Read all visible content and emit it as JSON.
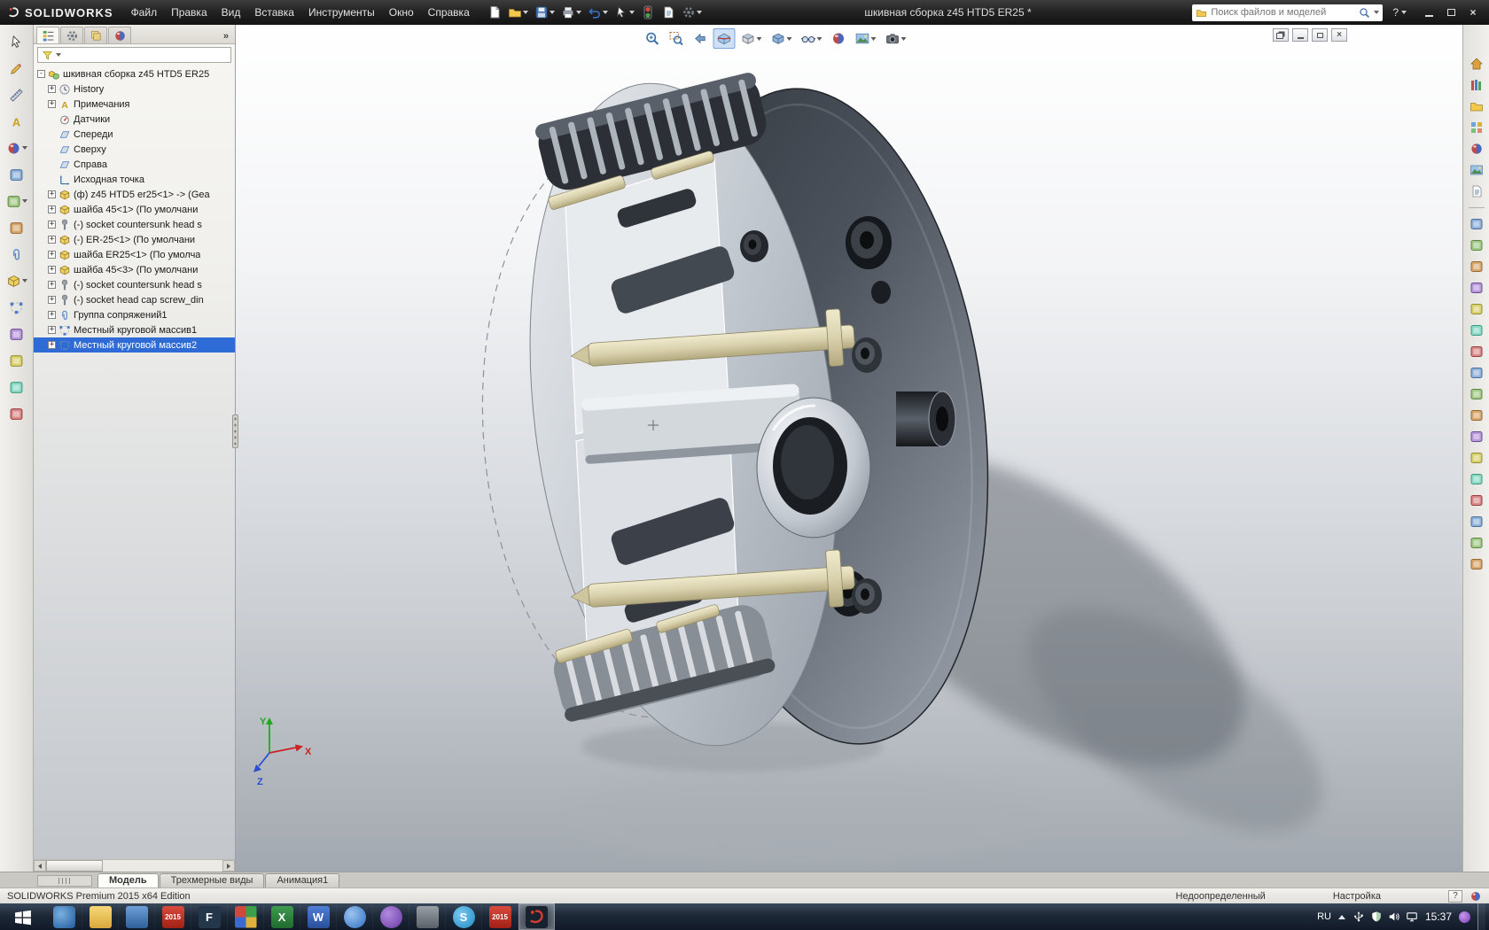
{
  "titlebar": {
    "app_name": "SOLIDWORKS",
    "document_title": "шкивная сборка z45 HTD5 ER25 *",
    "search_placeholder": "Поиск файлов и моделей",
    "help_label": "?",
    "menus": [
      "Файл",
      "Правка",
      "Вид",
      "Вставка",
      "Инструменты",
      "Окно",
      "Справка"
    ],
    "quick_tools": [
      {
        "name": "new-document-icon",
        "icon": "new",
        "caret": false
      },
      {
        "name": "open-icon",
        "icon": "open",
        "caret": true
      },
      {
        "name": "save-icon",
        "icon": "save",
        "caret": true
      },
      {
        "name": "print-icon",
        "icon": "print",
        "caret": true
      },
      {
        "name": "undo-icon",
        "icon": "undo",
        "caret": true
      },
      {
        "name": "select-icon",
        "icon": "cursor",
        "caret": true
      },
      {
        "name": "rebuild-icon",
        "icon": "rebuild",
        "caret": false
      },
      {
        "name": "file-properties-icon",
        "icon": "props",
        "caret": false
      },
      {
        "name": "options-icon",
        "icon": "gear",
        "caret": true
      }
    ]
  },
  "left_toolbar": [
    {
      "name": "select-tool",
      "icon": "cursor",
      "caret": false
    },
    {
      "name": "sketch-tool",
      "icon": "pencil",
      "caret": false
    },
    {
      "name": "dimension-tool",
      "icon": "ruler",
      "caret": false
    },
    {
      "name": "annotation-tool",
      "icon": "annA",
      "caret": false
    },
    {
      "name": "appearance-tool",
      "icon": "ball",
      "caret": true
    },
    {
      "name": "measure-tool",
      "icon": "gen1",
      "caret": false
    },
    {
      "name": "mass-properties-tool",
      "icon": "gen2",
      "caret": true
    },
    {
      "name": "interference-tool",
      "icon": "gen3",
      "caret": false
    },
    {
      "name": "mate-tool",
      "icon": "mates",
      "caret": false
    },
    {
      "name": "component-tool",
      "icon": "part",
      "caret": true
    },
    {
      "name": "pattern-tool",
      "icon": "pattern",
      "caret": false
    },
    {
      "name": "exploded-view-tool",
      "icon": "gen4",
      "caret": false
    },
    {
      "name": "assembly-features-tool",
      "icon": "gen5",
      "caret": false
    },
    {
      "name": "motion-tool",
      "icon": "gen6",
      "caret": false
    },
    {
      "name": "simulation-tool",
      "icon": "gen7",
      "caret": false
    }
  ],
  "feature_manager": {
    "tabs": [
      "featuremanager-tab",
      "propertymanager-tab",
      "configurationmanager-tab",
      "displaymanager-tab"
    ],
    "overflow_glyph": "»",
    "tree": [
      {
        "label": "шкивная сборка z45 HTD5 ER25",
        "icon": "asm",
        "expand": "minus",
        "indent": 0,
        "selected": false
      },
      {
        "label": "History",
        "icon": "hist",
        "expand": "plus",
        "indent": 1,
        "selected": false
      },
      {
        "label": "Примечания",
        "icon": "annA",
        "expand": "plus",
        "indent": 1,
        "selected": false
      },
      {
        "label": "Датчики",
        "icon": "sens",
        "expand": "none",
        "indent": 1,
        "selected": false
      },
      {
        "label": "Спереди",
        "icon": "plane",
        "expand": "none",
        "indent": 1,
        "selected": false
      },
      {
        "label": "Сверху",
        "icon": "plane",
        "expand": "none",
        "indent": 1,
        "selected": false
      },
      {
        "label": "Справа",
        "icon": "plane",
        "expand": "none",
        "indent": 1,
        "selected": false
      },
      {
        "label": "Исходная точка",
        "icon": "origin",
        "expand": "none",
        "indent": 1,
        "selected": false
      },
      {
        "label": "(ф) z45 HTD5 er25<1> -> (Gea",
        "icon": "part",
        "expand": "plus",
        "indent": 1,
        "selected": false
      },
      {
        "label": "шайба 45<1> (По умолчани",
        "icon": "part",
        "expand": "plus",
        "indent": 1,
        "selected": false
      },
      {
        "label": "(-) socket countersunk head s",
        "icon": "screw",
        "expand": "plus",
        "indent": 1,
        "selected": false
      },
      {
        "label": "(-) ER-25<1> (По умолчани",
        "icon": "part",
        "expand": "plus",
        "indent": 1,
        "selected": false
      },
      {
        "label": "шайба ER25<1> (По умолча",
        "icon": "part",
        "expand": "plus",
        "indent": 1,
        "selected": false
      },
      {
        "label": "шайба 45<3> (По умолчани",
        "icon": "part",
        "expand": "plus",
        "indent": 1,
        "selected": false
      },
      {
        "label": "(-) socket countersunk head s",
        "icon": "screw",
        "expand": "plus",
        "indent": 1,
        "selected": false
      },
      {
        "label": "(-) socket head cap screw_din",
        "icon": "screw",
        "expand": "plus",
        "indent": 1,
        "selected": false
      },
      {
        "label": "Группа сопряжений1",
        "icon": "mates",
        "expand": "plus",
        "indent": 1,
        "selected": false
      },
      {
        "label": "Местный круговой массив1",
        "icon": "pattern",
        "expand": "plus",
        "indent": 1,
        "selected": false
      },
      {
        "label": "Местный круговой массив2",
        "icon": "pattern",
        "expand": "plus",
        "indent": 1,
        "selected": true
      }
    ]
  },
  "viewport": {
    "headsup": [
      {
        "name": "zoom-fit-icon",
        "icon": "magfit",
        "caret": false,
        "active": false
      },
      {
        "name": "zoom-area-icon",
        "icon": "magarea",
        "caret": false,
        "active": false
      },
      {
        "name": "previous-view-icon",
        "icon": "prevview",
        "caret": false,
        "active": false
      },
      {
        "name": "section-view-icon",
        "icon": "section",
        "caret": false,
        "active": true
      },
      {
        "name": "view-orientation-icon",
        "icon": "cube",
        "caret": true,
        "active": false
      },
      {
        "name": "display-style-icon",
        "icon": "displaycube",
        "caret": true,
        "active": false
      },
      {
        "name": "hide-show-items-icon",
        "icon": "glasses",
        "caret": true,
        "active": false
      },
      {
        "name": "edit-appearance-icon",
        "icon": "ball",
        "caret": false,
        "active": false
      },
      {
        "name": "apply-scene-icon",
        "icon": "scene",
        "caret": true,
        "active": false
      },
      {
        "name": "view-settings-icon",
        "icon": "camera",
        "caret": true,
        "active": false
      }
    ],
    "triad": {
      "x": "X",
      "y": "Y",
      "z": "Z"
    }
  },
  "task_pane": [
    {
      "name": "solidworks-resources-icon",
      "icon": "home"
    },
    {
      "name": "design-library-icon",
      "icon": "books"
    },
    {
      "name": "file-explorer-icon",
      "icon": "open"
    },
    {
      "name": "view-palette-icon",
      "icon": "palette"
    },
    {
      "name": "appearances-icon",
      "icon": "ball"
    },
    {
      "name": "scenes-icon",
      "icon": "scene"
    },
    {
      "name": "custom-properties-icon",
      "icon": "props"
    }
  ],
  "right_toolbar_count": 17,
  "doc_tabs": [
    {
      "label": "Модель",
      "active": true
    },
    {
      "label": "Трехмерные виды",
      "active": false
    },
    {
      "label": "Анимация1",
      "active": false
    }
  ],
  "status_bar": {
    "edition": "SOLIDWORKS Premium 2015 x64 Edition",
    "state": "Недоопределенный",
    "settings": "Настройка",
    "help": "?"
  },
  "taskbar": {
    "language": "RU",
    "time": "15:37",
    "tray_icons": [
      "usb-icon",
      "shield-icon",
      "volume-icon",
      "network-icon"
    ],
    "apps": [
      {
        "name": "app-media",
        "style": "blue-e",
        "label": "",
        "active": false
      },
      {
        "name": "file-explorer",
        "style": "folder",
        "label": "",
        "active": false
      },
      {
        "name": "app-save",
        "style": "disk",
        "label": "",
        "active": false
      },
      {
        "name": "solidworks-2015-installer",
        "style": "red2015",
        "label": "2015",
        "active": false
      },
      {
        "name": "app-f",
        "style": "letter-f",
        "label": "F",
        "active": false
      },
      {
        "name": "app-office",
        "style": "quad",
        "label": "",
        "active": false
      },
      {
        "name": "excel",
        "style": "excel",
        "label": "X",
        "active": false
      },
      {
        "name": "word",
        "style": "word",
        "label": "W",
        "active": false
      },
      {
        "name": "app-blue-circle",
        "style": "bluecircle",
        "label": "",
        "active": false
      },
      {
        "name": "viber",
        "style": "viber",
        "label": "",
        "active": false
      },
      {
        "name": "app-gray",
        "style": "gray",
        "label": "",
        "active": false
      },
      {
        "name": "skype",
        "style": "skype",
        "label": "S",
        "active": false
      },
      {
        "name": "solidworks-2015-red",
        "style": "red2015",
        "label": "2015",
        "active": false
      },
      {
        "name": "solidworks-active",
        "style": "sw",
        "label": "",
        "active": true
      }
    ]
  }
}
